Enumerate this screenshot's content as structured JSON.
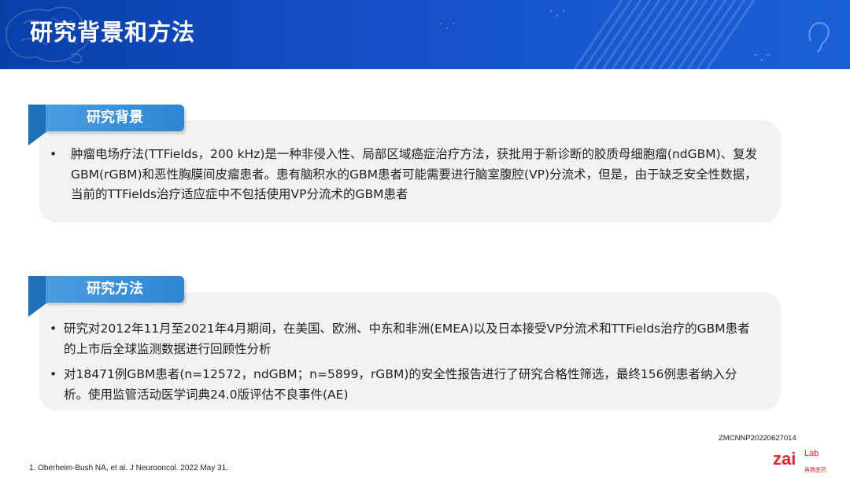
{
  "header": {
    "title": "研究背景和方法"
  },
  "sections": [
    {
      "label": "研究背景",
      "bullets": [
        "肿瘤电场疗法(TTFields，200 kHz)是一种非侵入性、局部区域癌症治疗方法，获批用于新诊断的胶质母细胞瘤(ndGBM)、复发GBM(rGBM)和恶性胸膜间皮瘤患者。患有脑积水的GBM患者可能需要进行脑室腹腔(VP)分流术，但是，由于缺乏安全性数据，当前的TTFields治疗适应症中不包括使用VP分流术的GBM患者"
      ]
    },
    {
      "label": "研究方法",
      "bullets": [
        "研究对2012年11月至2021年4月期间，在美国、欧洲、中东和非洲(EMEA)以及日本接受VP分流术和TTFields治疗的GBM患者的上市后全球监测数据进行回顾性分析",
        "对18471例GBM患者(n=12572，ndGBM；n=5899，rGBM)的安全性报告进行了研究合格性筛选，最终156例患者纳入分析。使用监管活动医学词典24.0版评估不良事件(AE)"
      ]
    }
  ],
  "bullet_symbol": "•",
  "footnote": "1.   Oberheim-Bush NA, et al. J Neurooncol. 2022 May 31.",
  "doc_code": "ZMCNNP20220627014",
  "logo": {
    "main": "zai",
    "sup": "Lab",
    "sub": "再鼎医药"
  },
  "colors": {
    "header": "#1450c8",
    "tab": "#3a90d8",
    "panel": "#f2f2f2",
    "logo_red": "#e4262b"
  }
}
